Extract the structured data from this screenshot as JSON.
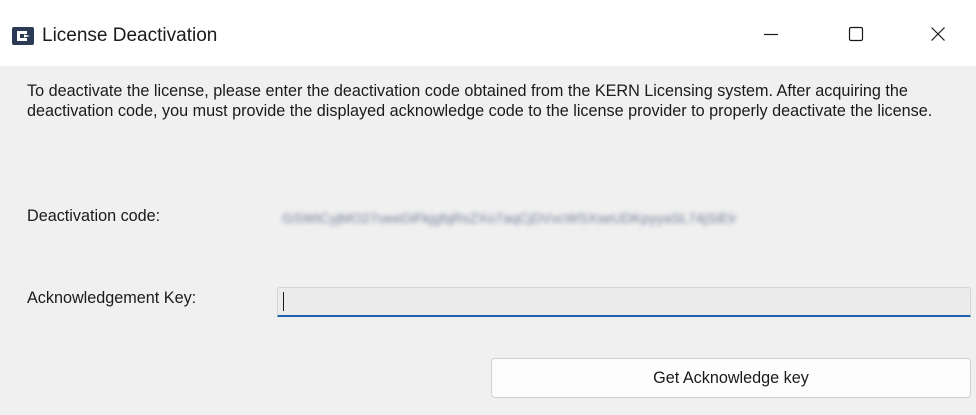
{
  "window": {
    "title": "License Deactivation",
    "controls": {
      "minimize_icon": "minimize-icon",
      "maximize_icon": "maximize-icon",
      "close_icon": "close-icon"
    }
  },
  "main": {
    "description": "To deactivate the license, please enter the deactivation code obtained from the KERN Licensing system. After acquiring the deactivation code, you must provide the displayed acknowledge code to the license provider to properly deactivate the license.",
    "deactivation_code": {
      "label": "Deactivation code:",
      "value": "GSWtCyjMO27oeeDiFkjgfqRsZXo7aqCjDVvcWSXseUDKpyyaSL74jSiEir"
    },
    "acknowledgement_key": {
      "label": "Acknowledgement Key:",
      "value": "",
      "placeholder": ""
    },
    "get_key_button": {
      "label": "Get Acknowledge key"
    }
  },
  "colors": {
    "background": "#f0f0f0",
    "titlebar": "#ffffff",
    "accent": "#1f5fb0",
    "app_icon": "#2b3a55"
  }
}
